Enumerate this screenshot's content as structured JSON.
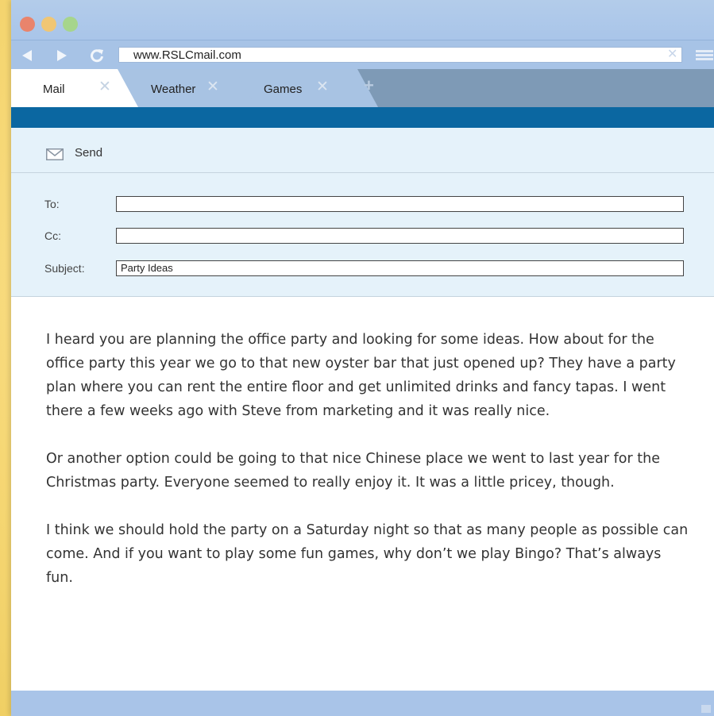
{
  "browser": {
    "url": "www.RSLCmail.com",
    "url_clear_icon": "close-icon",
    "tabs": [
      {
        "label": "Mail",
        "active": true
      },
      {
        "label": "Weather",
        "active": false
      },
      {
        "label": "Games",
        "active": false
      }
    ],
    "new_tab_icon": "plus-icon"
  },
  "toolbar": {
    "send_label": "Send",
    "send_icon": "envelope-icon"
  },
  "compose": {
    "to_label": "To:",
    "to_value": "",
    "cc_label": "Cc:",
    "cc_value": "",
    "subject_label": "Subject:",
    "subject_value": "Party Ideas"
  },
  "body": {
    "paragraphs": [
      "I heard you are planning the office party and looking for some ideas. How about for the office party this year we go to that new oyster bar that just opened up? They have a party plan where you can rent the entire floor and get unlimited drinks and fancy tapas. I went there a few weeks ago with Steve from marketing and it was really nice.",
      "Or another option could be going to that nice Chinese place we went to last year for the Christmas party. Everyone seemed to really enjoy it. It was a little pricey, though.",
      "I think we should hold the party on a Saturday night so that as many people as possible can come. And if you want to play some fun games, why don’t we play Bingo? That’s always fun."
    ]
  },
  "colors": {
    "accent_band": "#0b67a1",
    "header_bg": "#e5f2fa",
    "chrome": "#a9c5e9",
    "background": "#f6d774"
  }
}
